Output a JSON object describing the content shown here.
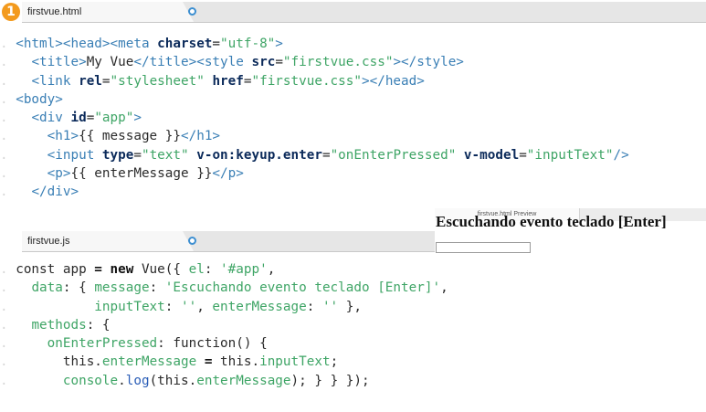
{
  "step_marker": "1",
  "html_file": {
    "tab": "firstvue.html",
    "lines": [
      {
        "indent": "",
        "tokens": [
          [
            "tag",
            "<html><head><meta "
          ],
          [
            "attr",
            "charset"
          ],
          [
            "txt",
            "="
          ],
          [
            "str",
            "\"utf-8\""
          ],
          [
            "tag",
            ">"
          ]
        ]
      },
      {
        "indent": "  ",
        "tokens": [
          [
            "tag",
            "<title>"
          ],
          [
            "txt",
            "My Vue"
          ],
          [
            "tag",
            "</title><style "
          ],
          [
            "attr",
            "src"
          ],
          [
            "txt",
            "="
          ],
          [
            "str",
            "\"firstvue.css\""
          ],
          [
            "tag",
            "></style>"
          ]
        ]
      },
      {
        "indent": "  ",
        "tokens": [
          [
            "tag",
            "<link "
          ],
          [
            "attr",
            "rel"
          ],
          [
            "txt",
            "="
          ],
          [
            "str",
            "\"stylesheet\""
          ],
          [
            "txt",
            " "
          ],
          [
            "attr",
            "href"
          ],
          [
            "txt",
            "="
          ],
          [
            "str",
            "\"firstvue.css\""
          ],
          [
            "tag",
            "></head>"
          ]
        ]
      },
      {
        "indent": "",
        "tokens": [
          [
            "tag",
            "<body>"
          ]
        ]
      },
      {
        "indent": "  ",
        "tokens": [
          [
            "tag",
            "<div "
          ],
          [
            "attr",
            "id"
          ],
          [
            "txt",
            "="
          ],
          [
            "str",
            "\"app\""
          ],
          [
            "tag",
            ">"
          ]
        ]
      },
      {
        "indent": "    ",
        "tokens": [
          [
            "tag",
            "<h1>"
          ],
          [
            "txt",
            "{{ message }}"
          ],
          [
            "tag",
            "</h1>"
          ]
        ]
      },
      {
        "indent": "    ",
        "tokens": [
          [
            "tag",
            "<input "
          ],
          [
            "attr",
            "type"
          ],
          [
            "txt",
            "="
          ],
          [
            "str",
            "\"text\""
          ],
          [
            "txt",
            " "
          ],
          [
            "attr",
            "v-on:keyup.enter"
          ],
          [
            "txt",
            "="
          ],
          [
            "str",
            "\"onEnterPressed\""
          ],
          [
            "txt",
            " "
          ],
          [
            "attr",
            "v-model"
          ],
          [
            "txt",
            "="
          ],
          [
            "str",
            "\"inputText\""
          ],
          [
            "tag",
            "/>"
          ]
        ]
      },
      {
        "indent": "    ",
        "tokens": [
          [
            "tag",
            "<p>"
          ],
          [
            "txt",
            "{{ enterMessage }}"
          ],
          [
            "tag",
            "</p>"
          ]
        ]
      },
      {
        "indent": "  ",
        "tokens": [
          [
            "tag",
            "</div>"
          ]
        ]
      }
    ]
  },
  "js_file": {
    "tab": "firstvue.js",
    "lines": [
      {
        "indent": "",
        "tokens": [
          [
            "txt",
            "const app "
          ],
          [
            "kw",
            "="
          ],
          [
            "txt",
            " "
          ],
          [
            "kw",
            "new"
          ],
          [
            "txt",
            " Vue({ "
          ],
          [
            "prop",
            "el"
          ],
          [
            "txt",
            ": "
          ],
          [
            "str",
            "'#app'"
          ],
          [
            "txt",
            ","
          ]
        ]
      },
      {
        "indent": "  ",
        "tokens": [
          [
            "prop",
            "data"
          ],
          [
            "txt",
            ": { "
          ],
          [
            "prop",
            "message"
          ],
          [
            "txt",
            ": "
          ],
          [
            "str",
            "'Escuchando evento teclado [Enter]'"
          ],
          [
            "txt",
            ","
          ]
        ]
      },
      {
        "indent": "          ",
        "tokens": [
          [
            "prop",
            "inputText"
          ],
          [
            "txt",
            ": "
          ],
          [
            "str",
            "''"
          ],
          [
            "txt",
            ", "
          ],
          [
            "prop",
            "enterMessage"
          ],
          [
            "txt",
            ": "
          ],
          [
            "str",
            "''"
          ],
          [
            "txt",
            " },"
          ]
        ]
      },
      {
        "indent": "  ",
        "tokens": [
          [
            "prop",
            "methods"
          ],
          [
            "txt",
            ": {"
          ]
        ]
      },
      {
        "indent": "    ",
        "tokens": [
          [
            "prop",
            "onEnterPressed"
          ],
          [
            "txt",
            ": function() {"
          ]
        ]
      },
      {
        "indent": "      ",
        "tokens": [
          [
            "txt",
            "this."
          ],
          [
            "prop",
            "enterMessage"
          ],
          [
            "txt",
            " "
          ],
          [
            "kw",
            "="
          ],
          [
            "txt",
            " this."
          ],
          [
            "prop",
            "inputText"
          ],
          [
            "txt",
            ";"
          ]
        ]
      },
      {
        "indent": "      ",
        "tokens": [
          [
            "prop",
            "console"
          ],
          [
            "txt",
            "."
          ],
          [
            "fn",
            "log"
          ],
          [
            "txt",
            "(this."
          ],
          [
            "prop",
            "enterMessage"
          ],
          [
            "txt",
            "); } } });"
          ]
        ]
      }
    ]
  },
  "preview": {
    "tab": "firstvue.html Preview",
    "heading": "Escuchando evento teclado [Enter]",
    "input_value": ""
  }
}
